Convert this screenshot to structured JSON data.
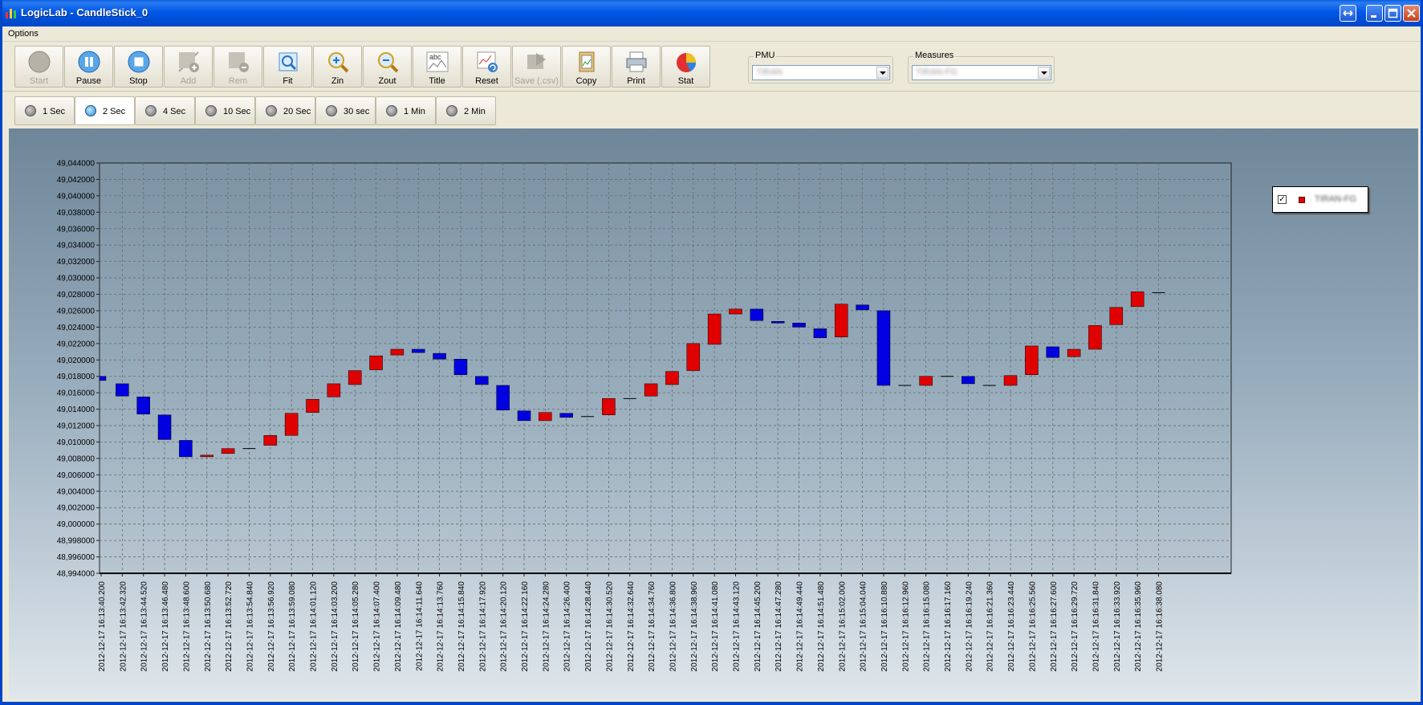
{
  "window": {
    "title": "LogicLab - CandleStick_0"
  },
  "menu": {
    "options_label": "Options"
  },
  "toolbar": {
    "buttons": [
      {
        "label": "Start",
        "icon": "start-icon",
        "enabled": false
      },
      {
        "label": "Pause",
        "icon": "pause-icon",
        "enabled": true
      },
      {
        "label": "Stop",
        "icon": "stop-icon",
        "enabled": true
      },
      {
        "label": "Add",
        "icon": "add-icon",
        "enabled": false
      },
      {
        "label": "Rem",
        "icon": "remove-icon",
        "enabled": false
      },
      {
        "label": "Fit",
        "icon": "fit-icon",
        "enabled": true
      },
      {
        "label": "Zin",
        "icon": "zoom-in-icon",
        "enabled": true
      },
      {
        "label": "Zout",
        "icon": "zoom-out-icon",
        "enabled": true
      },
      {
        "label": "Title",
        "icon": "title-icon",
        "enabled": true
      },
      {
        "label": "Reset",
        "icon": "reset-icon",
        "enabled": true
      },
      {
        "label": "Save (.csv)",
        "icon": "save-csv-icon",
        "enabled": false
      },
      {
        "label": "Copy",
        "icon": "copy-icon",
        "enabled": true
      },
      {
        "label": "Print",
        "icon": "print-icon",
        "enabled": true
      },
      {
        "label": "Stat",
        "icon": "stat-icon",
        "enabled": true
      }
    ]
  },
  "pmu": {
    "label": "PMU",
    "value": "TIRAN"
  },
  "measures": {
    "label": "Measures",
    "value": "TIRAN-FG"
  },
  "intervals": {
    "options": [
      "1 Sec",
      "2 Sec",
      "4 Sec",
      "10 Sec",
      "20 Sec",
      "30 sec",
      "1 Min",
      "2 Min"
    ],
    "selected": "2 Sec"
  },
  "legend": {
    "checked": true,
    "series_name": "TIRAN-FG",
    "color": "#e00000"
  },
  "colors": {
    "up": "#e00000",
    "down": "#0000e0",
    "grid": "#6a6a6a"
  },
  "chart_data": {
    "type": "candlestick",
    "ylim": [
      48.994,
      49.044
    ],
    "ytick_step": 0.002,
    "ytick_labels": [
      "49,044000",
      "49,042000",
      "49,040000",
      "49,038000",
      "49,036000",
      "49,034000",
      "49,032000",
      "49,030000",
      "49,028000",
      "49,026000",
      "49,024000",
      "49,022000",
      "49,020000",
      "49,018000",
      "49,016000",
      "49,014000",
      "49,012000",
      "49,010000",
      "49,008000",
      "49,006000",
      "49,004000",
      "49,002000",
      "49,000000",
      "48,998000",
      "48,996000",
      "48,994000"
    ],
    "grid": true,
    "legend_position": "top-right",
    "categories": [
      "2012-12-17 16:13:40.200",
      "2012-12-17 16:13:42.320",
      "2012-12-17 16:13:44.520",
      "2012-12-17 16:13:46.480",
      "2012-12-17 16:13:48.600",
      "2012-12-17 16:13:50.680",
      "2012-12-17 16:13:52.720",
      "2012-12-17 16:13:54.840",
      "2012-12-17 16:13:56.920",
      "2012-12-17 16:13:59.080",
      "2012-12-17 16:14:01.120",
      "2012-12-17 16:14:03.200",
      "2012-12-17 16:14:05.280",
      "2012-12-17 16:14:07.400",
      "2012-12-17 16:14:09.480",
      "2012-12-17 16:14:11.640",
      "2012-12-17 16:14:13.760",
      "2012-12-17 16:14:15.840",
      "2012-12-17 16:14:17.920",
      "2012-12-17 16:14:20.120",
      "2012-12-17 16:14:22.160",
      "2012-12-17 16:14:24.280",
      "2012-12-17 16:14:26.400",
      "2012-12-17 16:14:28.440",
      "2012-12-17 16:14:30.520",
      "2012-12-17 16:14:32.640",
      "2012-12-17 16:14:34.760",
      "2012-12-17 16:14:36.800",
      "2012-12-17 16:14:38.960",
      "2012-12-17 16:14:41.080",
      "2012-12-17 16:14:43.120",
      "2012-12-17 16:14:45.200",
      "2012-12-17 16:14:47.280",
      "2012-12-17 16:14:49.440",
      "2012-12-17 16:14:51.480",
      "2012-12-17 16:15:02.000",
      "2012-12-17 16:15:04.040",
      "2012-12-17 16:16:10.880",
      "2012-12-17 16:16:12.960",
      "2012-12-17 16:16:15.080",
      "2012-12-17 16:16:17.160",
      "2012-12-17 16:16:19.240",
      "2012-12-17 16:16:21.360",
      "2012-12-17 16:16:23.440",
      "2012-12-17 16:16:25.560",
      "2012-12-17 16:16:27.600",
      "2012-12-17 16:16:29.720",
      "2012-12-17 16:16:31.840",
      "2012-12-17 16:16:33.920",
      "2012-12-17 16:16:35.960",
      "2012-12-17 16:16:38.080"
    ],
    "series": [
      {
        "name": "TIRAN-FG",
        "open": [
          49.018,
          49.0171,
          49.0155,
          49.0133,
          49.0102,
          49.0082,
          49.0086,
          49.0092,
          49.0096,
          49.0108,
          49.0136,
          49.0155,
          49.017,
          49.0188,
          49.0206,
          49.0213,
          49.0208,
          49.0201,
          49.018,
          49.0169,
          49.0138,
          49.0126,
          49.0135,
          49.0131,
          49.0133,
          49.0153,
          49.0156,
          49.017,
          49.0187,
          49.0219,
          49.0256,
          49.0262,
          49.0247,
          49.0245,
          49.0238,
          49.0228,
          49.0267,
          49.026,
          49.0169,
          49.0169,
          49.018,
          49.018,
          49.0169,
          49.0169,
          49.0182,
          49.0216,
          49.0204,
          49.0213,
          49.0243,
          49.0265,
          49.0282
        ],
        "close": [
          49.0175,
          49.0156,
          49.0134,
          49.0103,
          49.0082,
          49.0084,
          49.0092,
          49.0092,
          49.0108,
          49.0135,
          49.0152,
          49.0171,
          49.0187,
          49.0205,
          49.0213,
          49.0209,
          49.0201,
          49.0182,
          49.017,
          49.0139,
          49.0126,
          49.0136,
          49.013,
          49.0131,
          49.0153,
          49.0153,
          49.0171,
          49.0186,
          49.022,
          49.0256,
          49.0262,
          49.0248,
          49.0245,
          49.024,
          49.0227,
          49.0268,
          49.0261,
          49.0169,
          49.0169,
          49.018,
          49.018,
          49.0171,
          49.0169,
          49.0181,
          49.0217,
          49.0203,
          49.0213,
          49.0242,
          49.0264,
          49.0283,
          49.0282
        ]
      }
    ]
  }
}
